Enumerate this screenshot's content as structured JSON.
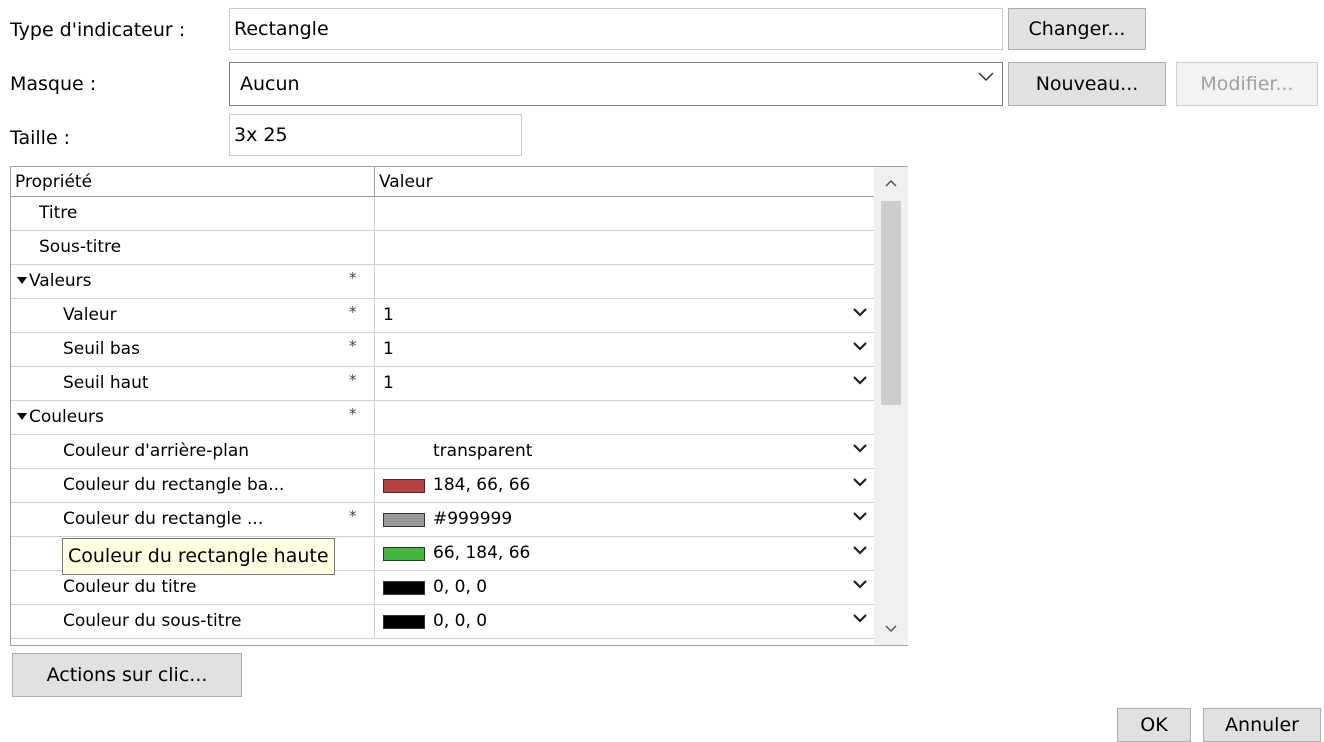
{
  "form": {
    "type_label": "Type d'indicateur :",
    "type_value": "Rectangle",
    "change_button": "Changer...",
    "mask_label": "Masque :",
    "mask_value": "Aucun",
    "new_button": "Nouveau...",
    "modify_button": "Modifier...",
    "size_label": "Taille :",
    "size_value": "3x 25"
  },
  "grid": {
    "headers": {
      "property": "Propriété",
      "value": "Valeur"
    },
    "rows": [
      {
        "name": "Titre",
        "star": "",
        "value": ""
      },
      {
        "name": "Sous-titre",
        "star": "",
        "value": ""
      },
      {
        "name": "Valeurs",
        "star": "*",
        "value": ""
      },
      {
        "name": "Valeur",
        "star": "*",
        "value": "1"
      },
      {
        "name": "Seuil bas",
        "star": "*",
        "value": "1"
      },
      {
        "name": "Seuil haut",
        "star": "*",
        "value": "1"
      },
      {
        "name": "Couleurs",
        "star": "*",
        "value": ""
      },
      {
        "name": "Couleur d'arrière-plan",
        "star": "",
        "value": "transparent"
      },
      {
        "name": "Couleur du rectangle ba...",
        "star": "",
        "value": "184, 66, 66",
        "color": "#b84242"
      },
      {
        "name": "Couleur du rectangle ...",
        "star": "*",
        "value": "#999999",
        "color": "#999999"
      },
      {
        "name": "",
        "star": "",
        "value": "66, 184, 66",
        "color": "#42b842"
      },
      {
        "name": "Couleur du titre",
        "star": "",
        "value": "0, 0, 0",
        "color": "#000000"
      },
      {
        "name": "Couleur du sous-titre",
        "star": "",
        "value": "0, 0, 0",
        "color": "#000000"
      }
    ]
  },
  "tooltip": "Couleur du rectangle haute",
  "actions_button": "Actions sur clic...",
  "ok_button": "OK",
  "cancel_button": "Annuler"
}
